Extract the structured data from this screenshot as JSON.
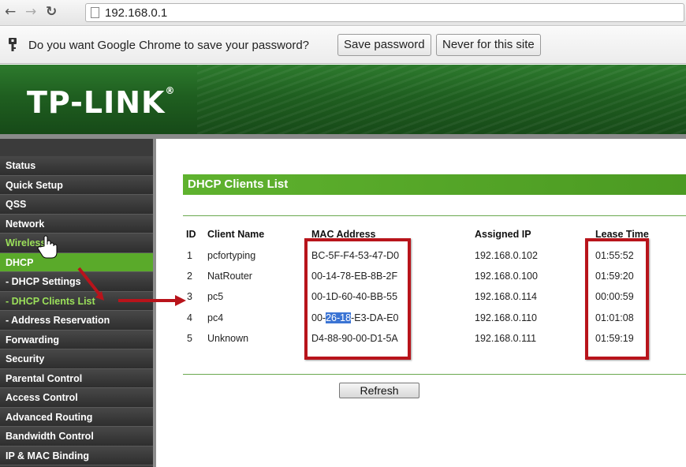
{
  "browser": {
    "url": "192.168.0.1",
    "back_icon": "back-arrow-icon",
    "forward_icon": "forward-arrow-icon",
    "reload_icon": "reload-icon"
  },
  "infobar": {
    "message": "Do you want Google Chrome to save your password?",
    "save_label": "Save password",
    "never_label": "Never for this site"
  },
  "brand": {
    "logo": "TP-LINK",
    "registered": "®"
  },
  "sidebar": {
    "items": [
      {
        "label": "Status"
      },
      {
        "label": "Quick Setup"
      },
      {
        "label": "QSS"
      },
      {
        "label": "Network"
      },
      {
        "label": "Wireless"
      },
      {
        "label": "DHCP"
      },
      {
        "label": "- DHCP Settings"
      },
      {
        "label": "- DHCP Clients List"
      },
      {
        "label": "- Address Reservation"
      },
      {
        "label": "Forwarding"
      },
      {
        "label": "Security"
      },
      {
        "label": "Parental Control"
      },
      {
        "label": "Access Control"
      },
      {
        "label": "Advanced Routing"
      },
      {
        "label": "Bandwidth Control"
      },
      {
        "label": "IP & MAC Binding"
      }
    ]
  },
  "main": {
    "title": "DHCP Clients List",
    "columns": [
      "ID",
      "Client Name",
      "MAC Address",
      "Assigned IP",
      "Lease Time"
    ],
    "rows": [
      {
        "id": "1",
        "name": "pcfortyping",
        "mac": "BC-5F-F4-53-47-D0",
        "ip": "192.168.0.102",
        "lease": "01:55:52"
      },
      {
        "id": "2",
        "name": "NatRouter",
        "mac": "00-14-78-EB-8B-2F",
        "ip": "192.168.0.100",
        "lease": "01:59:20"
      },
      {
        "id": "3",
        "name": "pc5",
        "mac": "00-1D-60-40-BB-55",
        "ip": "192.168.0.114",
        "lease": "00:00:59"
      },
      {
        "id": "4",
        "name": "pc4",
        "mac_pre": "00-",
        "mac_sel": "26-18",
        "mac_post": "-E3-DA-E0",
        "ip": "192.168.0.110",
        "lease": "01:01:08"
      },
      {
        "id": "5",
        "name": "Unknown",
        "mac": "D4-88-90-00-D1-5A",
        "ip": "192.168.0.111",
        "lease": "01:59:19"
      }
    ],
    "refresh_label": "Refresh"
  },
  "colors": {
    "accent_green": "#5aaa2a",
    "annotation_red": "#b8141b",
    "selection_blue": "#3b74d4"
  }
}
